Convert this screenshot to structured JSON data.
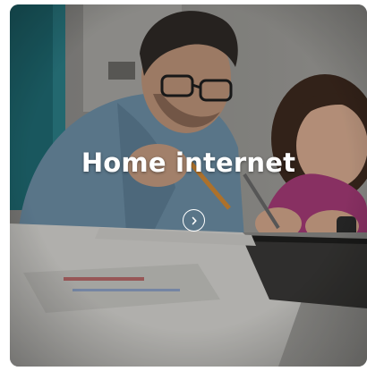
{
  "card": {
    "title": "Home internet",
    "image_alt": "father-helping-daughter-with-homework-photo",
    "action_icon": "chevron-right-icon"
  }
}
